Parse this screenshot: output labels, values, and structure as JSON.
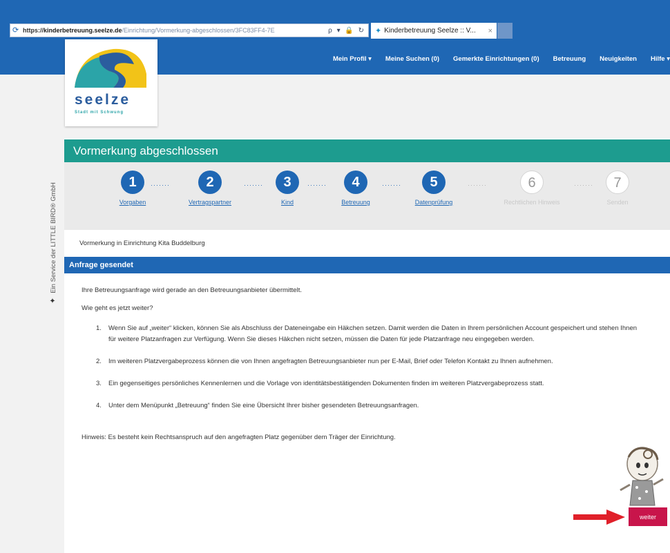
{
  "browser": {
    "protocol": "https://",
    "domain": "kinderbetreuung.seelze.de",
    "path": "/Einrichtung/Vormerkung-abgeschlossen/3FC83FF4-7E",
    "actions": "ρ ▾ 🔒 ↻",
    "tab_title": "Kinderbetreuung Seelze :: V...",
    "tab_close": "×"
  },
  "nav": {
    "items": [
      "Mein Profil ▾",
      "Meine Suchen (0)",
      "Gemerkte Einrichtungen (0)",
      "Betreuung",
      "Neuigkeiten",
      "Hilfe ▾"
    ]
  },
  "logo": {
    "name": "seelze",
    "tagline": "Stadt mit Schwung"
  },
  "side": {
    "text": "Ein Service der LITTLE BIRD® GmbH"
  },
  "page": {
    "title": "Vormerkung abgeschlossen",
    "steps": [
      {
        "num": "1",
        "label": "Vorgaben"
      },
      {
        "num": "2",
        "label": "Vertragspartner"
      },
      {
        "num": "3",
        "label": "Kind"
      },
      {
        "num": "4",
        "label": "Betreuung"
      },
      {
        "num": "5",
        "label": "Datenprüfung"
      },
      {
        "num": "6",
        "label": "Rechtlichen Hinweis"
      },
      {
        "num": "7",
        "label": "Senden"
      }
    ],
    "dots": "·······",
    "location": "Vormerkung in Einrichtung Kita Buddelburg",
    "section_title": "Anfrage gesendet",
    "message": "Ihre Betreuungsanfrage wird gerade an den Betreuungsanbieter übermittelt.",
    "question": "Wie geht es jetzt weiter?",
    "list": [
      {
        "num": "1.",
        "text": "Wenn Sie auf „weiter“ klicken, können Sie als Abschluss der Dateneingabe ein Häkchen setzen. Damit werden die Daten in Ihrem persönlichen Account gespeichert und stehen Ihnen für weitere Platzanfragen zur Verfügung. Wenn Sie dieses Häkchen nicht setzen, müssen die Daten für jede Platzanfrage neu eingegeben werden."
      },
      {
        "num": "2.",
        "text": "Im weiteren Platzvergabeprozess können die von Ihnen angefragten Betreuungsanbieter nun per E-Mail, Brief oder Telefon Kontakt zu Ihnen aufnehmen."
      },
      {
        "num": "3.",
        "text": "Ein gegenseitiges persönliches Kennenlernen und die Vorlage von identitätsbestätigenden Dokumenten finden im weiteren Platzvergabeprozess statt."
      },
      {
        "num": "4.",
        "text": "Unter dem Menüpunkt „Betreuung“ finden Sie eine Übersicht Ihrer bisher gesendeten Betreuungsanfragen."
      }
    ],
    "note": "Hinweis: Es besteht kein Rechtsanspruch auf den angefragten Platz gegenüber dem Träger der Einrichtung.",
    "next_button": "weiter"
  },
  "colors": {
    "primary_blue": "#1f67b4",
    "teal": "#1d9c8f",
    "button": "#c8154b",
    "arrow": "#e0202a"
  }
}
